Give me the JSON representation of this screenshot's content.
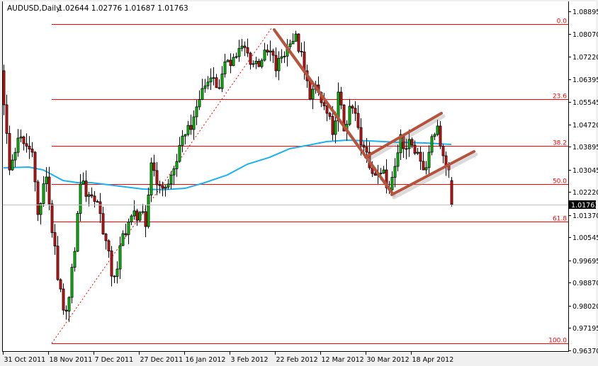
{
  "header": {
    "symbol": "AUDUSD,Daily",
    "ohlc": "1.02644 1.02776 1.01687 1.01763"
  },
  "chart_data": {
    "type": "candlestick",
    "title": "AUDUSD,Daily",
    "ylim": [
      0.9637,
      1.08895
    ],
    "y_ticks": [
      "1.08895",
      "1.08070",
      "1.07220",
      "1.06395",
      "1.05545",
      "1.04720",
      "1.03895",
      "1.03045",
      "1.02220",
      "1.01370",
      "1.00545",
      "0.99695",
      "0.98870",
      "0.98020",
      "0.97195",
      "0.96370"
    ],
    "x_ticks": [
      {
        "bar": 0,
        "label": "31 Oct 2011"
      },
      {
        "bar": 16,
        "label": "18 Nov 2011"
      },
      {
        "bar": 32,
        "label": "7 Dec 2011"
      },
      {
        "bar": 48,
        "label": "27 Dec 2011"
      },
      {
        "bar": 64,
        "label": "16 Jan 2012"
      },
      {
        "bar": 80,
        "label": "3 Feb 2012"
      },
      {
        "bar": 96,
        "label": "22 Feb 2012"
      },
      {
        "bar": 112,
        "label": "12 Mar 2012"
      },
      {
        "bar": 128,
        "label": "30 Mar 2012"
      },
      {
        "bar": 144,
        "label": "18 Apr 2012"
      }
    ],
    "bar_count": 159,
    "first_open": 1.067,
    "close_keypoints": [
      [
        0,
        1.05443
      ],
      [
        2,
        1.03037
      ],
      [
        5,
        1.04214
      ],
      [
        10,
        1.03691
      ],
      [
        12,
        1.0139
      ],
      [
        15,
        1.02776
      ],
      [
        19,
        0.98984
      ],
      [
        21,
        0.97859
      ],
      [
        23,
        0.9833
      ],
      [
        25,
        1.0003
      ],
      [
        27,
        1.02514
      ],
      [
        30,
        1.02122
      ],
      [
        33,
        1.01861
      ],
      [
        36,
        1.00422
      ],
      [
        38,
        0.99115
      ],
      [
        40,
        0.99376
      ],
      [
        42,
        1.00684
      ],
      [
        45,
        1.01337
      ],
      [
        48,
        1.01468
      ],
      [
        50,
        1.00945
      ],
      [
        52,
        1.03299
      ],
      [
        55,
        1.02462
      ],
      [
        58,
        1.02514
      ],
      [
        61,
        1.03351
      ],
      [
        64,
        1.04345
      ],
      [
        67,
        1.04999
      ],
      [
        70,
        1.06045
      ],
      [
        73,
        1.06437
      ],
      [
        76,
        1.06045
      ],
      [
        79,
        1.07091
      ],
      [
        82,
        1.07221
      ],
      [
        84,
        1.07614
      ],
      [
        86,
        1.07352
      ],
      [
        88,
        1.0696
      ],
      [
        91,
        1.07091
      ],
      [
        94,
        1.07431
      ],
      [
        96,
        1.06698
      ],
      [
        98,
        1.07221
      ],
      [
        101,
        1.07692
      ],
      [
        103,
        1.08058
      ],
      [
        106,
        1.06698
      ],
      [
        108,
        1.05652
      ],
      [
        110,
        1.06175
      ],
      [
        112,
        1.05522
      ],
      [
        114,
        1.05129
      ],
      [
        116,
        1.04345
      ],
      [
        118,
        1.05914
      ],
      [
        120,
        1.04476
      ],
      [
        122,
        1.05391
      ],
      [
        124,
        1.05129
      ],
      [
        126,
        1.03953
      ],
      [
        128,
        1.03691
      ],
      [
        130,
        1.02907
      ],
      [
        132,
        1.02907
      ],
      [
        134,
        1.03037
      ],
      [
        136,
        1.02305
      ],
      [
        138,
        1.03168
      ],
      [
        140,
        1.04345
      ],
      [
        142,
        1.03822
      ],
      [
        144,
        1.03953
      ],
      [
        146,
        1.03691
      ],
      [
        148,
        1.03037
      ],
      [
        150,
        1.03691
      ],
      [
        152,
        1.04345
      ],
      [
        153,
        1.04659
      ],
      [
        155,
        1.0356
      ],
      [
        157,
        1.03037
      ],
      [
        158,
        1.01763
      ]
    ],
    "last_bar": {
      "open": 1.02644,
      "high": 1.02776,
      "low": 1.01687,
      "close": 1.01763
    },
    "current_price": "1.01763",
    "moving_average": {
      "color": "#1ab2f0",
      "points": [
        [
          0,
          1.03116
        ],
        [
          9,
          1.03142
        ],
        [
          14,
          1.03037
        ],
        [
          21,
          1.02645
        ],
        [
          26,
          1.02567
        ],
        [
          31,
          1.02567
        ],
        [
          39,
          1.02462
        ],
        [
          49,
          1.02331
        ],
        [
          56,
          1.02305
        ],
        [
          64,
          1.02357
        ],
        [
          71,
          1.02567
        ],
        [
          79,
          1.02854
        ],
        [
          86,
          1.03246
        ],
        [
          94,
          1.03508
        ],
        [
          101,
          1.03822
        ],
        [
          109,
          1.03979
        ],
        [
          114,
          1.04083
        ],
        [
          121,
          1.04135
        ],
        [
          129,
          1.04109
        ],
        [
          139,
          1.04057
        ],
        [
          149,
          1.04031
        ],
        [
          158,
          1.03979
        ]
      ]
    },
    "fibonacci": {
      "color": "#ff0000",
      "start_bar": 17,
      "high": 1.08424,
      "low": 0.9663,
      "levels": [
        {
          "label": "0.0",
          "ratio": 0.0
        },
        {
          "label": "23.6",
          "ratio": 0.236
        },
        {
          "label": "38.2",
          "ratio": 0.382
        },
        {
          "label": "50.0",
          "ratio": 0.5
        },
        {
          "label": "61.8",
          "ratio": 0.618
        },
        {
          "label": "100.0",
          "ratio": 1.0
        }
      ],
      "trend": {
        "from": [
          17,
          0.9663
        ],
        "to": [
          94.5,
          1.08268
        ]
      }
    },
    "trendlines": {
      "color": "#b5533c",
      "lines": [
        {
          "name": "downtrend-line",
          "from": [
            95.5,
            1.08215
          ],
          "to": [
            137,
            1.022
          ]
        },
        {
          "name": "channel-upper",
          "from": [
            127.75,
            1.03508
          ],
          "to": [
            154.5,
            1.05129
          ]
        },
        {
          "name": "channel-lower",
          "from": [
            137,
            1.02122
          ],
          "to": [
            166,
            1.03717
          ]
        }
      ]
    },
    "colors": {
      "up": "#00d000",
      "down": "#e01010",
      "outline": "#000000"
    }
  }
}
